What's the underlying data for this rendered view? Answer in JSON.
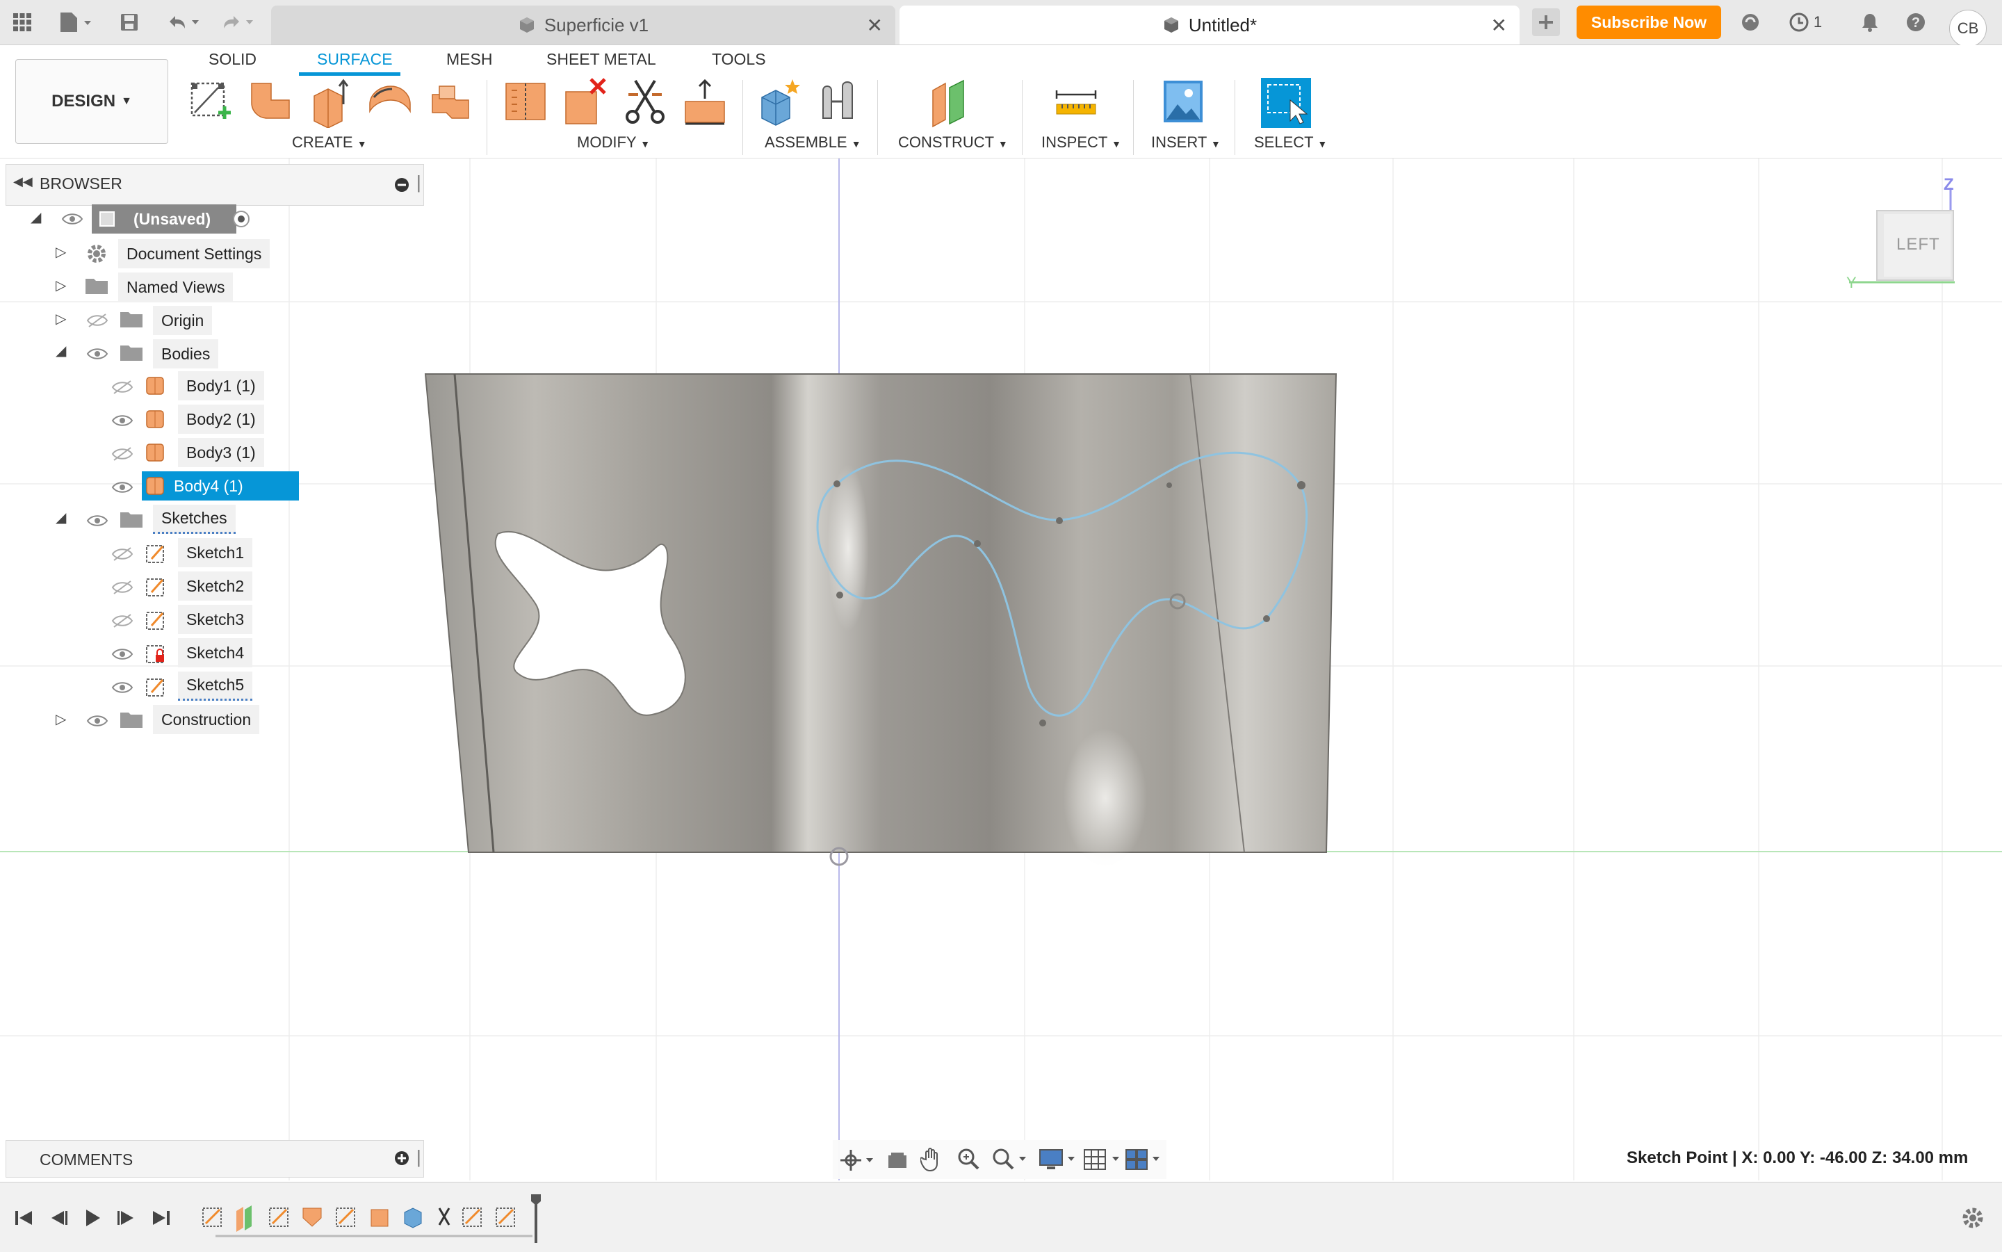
{
  "tabs": [
    {
      "label": "Superficie v1",
      "active": false
    },
    {
      "label": "Untitled*",
      "active": true
    }
  ],
  "topbar": {
    "subscribe_label": "Subscribe Now",
    "jobs_count": "1",
    "user_initials": "CB"
  },
  "ribbon": {
    "workspace_label": "DESIGN",
    "tabs": [
      "SOLID",
      "SURFACE",
      "MESH",
      "SHEET METAL",
      "TOOLS"
    ],
    "active_tab": "SURFACE",
    "groups": [
      "CREATE",
      "MODIFY",
      "ASSEMBLE",
      "CONSTRUCT",
      "INSPECT",
      "INSERT",
      "SELECT"
    ]
  },
  "browser": {
    "title": "BROWSER",
    "root": "(Unsaved)",
    "items": {
      "document_settings": "Document Settings",
      "named_views": "Named Views",
      "origin": "Origin",
      "bodies": "Bodies",
      "body1": "Body1 (1)",
      "body2": "Body2 (1)",
      "body3": "Body3 (1)",
      "body4": "Body4 (1)",
      "sketches": "Sketches",
      "sketch1": "Sketch1",
      "sketch2": "Sketch2",
      "sketch3": "Sketch3",
      "sketch4": "Sketch4",
      "sketch5": "Sketch5",
      "construction": "Construction"
    }
  },
  "viewcube": {
    "face": "LEFT",
    "axis_z": "Z",
    "axis_y": "Y"
  },
  "comments_label": "COMMENTS",
  "status_text": "Sketch Point | X: 0.00 Y: -46.00 Z: 34.00 mm",
  "colors": {
    "accent": "#0696d7",
    "subscribe": "#ff8c00",
    "selection": "#0696d7"
  }
}
